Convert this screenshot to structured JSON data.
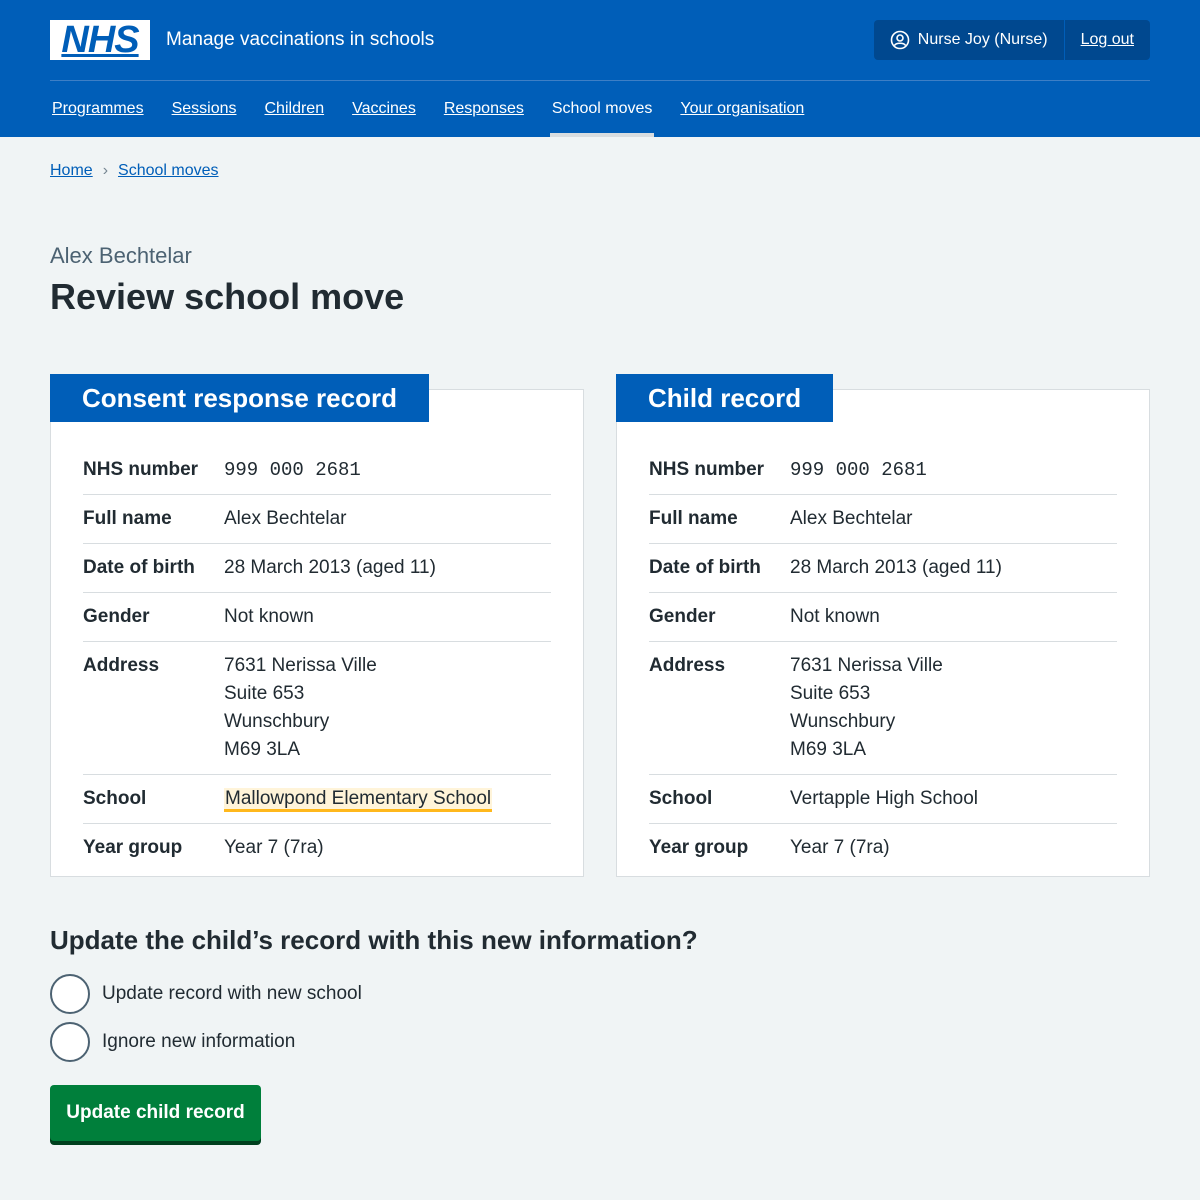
{
  "header": {
    "logo": "NHS",
    "service_name": "Manage vaccinations in schools",
    "user": "Nurse Joy (Nurse)",
    "logout": "Log out"
  },
  "nav": {
    "items": [
      {
        "label": "Programmes"
      },
      {
        "label": "Sessions"
      },
      {
        "label": "Children"
      },
      {
        "label": "Vaccines"
      },
      {
        "label": "Responses"
      },
      {
        "label": "School moves",
        "active": true
      },
      {
        "label": "Your organisation"
      }
    ]
  },
  "breadcrumb": {
    "home": "Home",
    "current": "School moves"
  },
  "page": {
    "caption": "Alex Bechtelar",
    "title": "Review school move"
  },
  "consent_card": {
    "heading": "Consent response record",
    "rows": {
      "nhs_number": {
        "key": "NHS number",
        "value": "999 000 2681"
      },
      "full_name": {
        "key": "Full name",
        "value": "Alex Bechtelar"
      },
      "dob": {
        "key": "Date of birth",
        "value": "28 March 2013 (aged 11)"
      },
      "gender": {
        "key": "Gender",
        "value": "Not known"
      },
      "address": {
        "key": "Address",
        "lines": [
          "7631 Nerissa Ville",
          "Suite 653",
          "Wunschbury",
          "M69 3LA"
        ]
      },
      "school": {
        "key": "School",
        "value": "Mallowpond Elementary School"
      },
      "year_group": {
        "key": "Year group",
        "value": "Year 7 (7ra)"
      }
    }
  },
  "child_card": {
    "heading": "Child record",
    "rows": {
      "nhs_number": {
        "key": "NHS number",
        "value": "999 000 2681"
      },
      "full_name": {
        "key": "Full name",
        "value": "Alex Bechtelar"
      },
      "dob": {
        "key": "Date of birth",
        "value": "28 March 2013 (aged 11)"
      },
      "gender": {
        "key": "Gender",
        "value": "Not known"
      },
      "address": {
        "key": "Address",
        "lines": [
          "7631 Nerissa Ville",
          "Suite 653",
          "Wunschbury",
          "M69 3LA"
        ]
      },
      "school": {
        "key": "School",
        "value": "Vertapple High School"
      },
      "year_group": {
        "key": "Year group",
        "value": "Year 7 (7ra)"
      }
    }
  },
  "form": {
    "question": "Update the child’s record with this new information?",
    "options": [
      {
        "label": "Update record with new school"
      },
      {
        "label": "Ignore new information"
      }
    ],
    "submit": "Update child record"
  },
  "colors": {
    "nhs_blue": "#005eb8",
    "background": "#f0f4f5",
    "button_green": "#007f3b",
    "highlight_yellow": "#ffb81c"
  }
}
